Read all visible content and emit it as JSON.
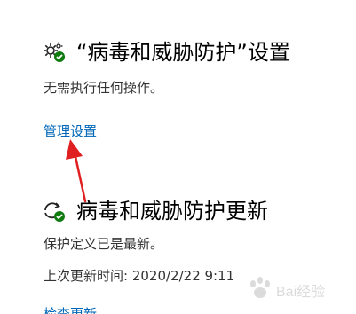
{
  "threat_protection_settings": {
    "icon": "gear-check-icon",
    "title": "“病毒和威胁防护”设置",
    "description": "无需执行任何操作。",
    "manage_link": "管理设置"
  },
  "threat_protection_updates": {
    "icon": "refresh-check-icon",
    "title": "病毒和威胁防护更新",
    "status": "保护定义已是最新。",
    "last_update": "上次更新时间: 2020/2/22 9:11",
    "cut_off_link": "检查更新"
  },
  "annotation": {
    "arrow_color": "#e02020"
  },
  "watermark": {
    "icon": "paw-logo",
    "text": "Bai经验"
  },
  "colors": {
    "link": "#0067b8",
    "status_ok": "#107c10"
  }
}
